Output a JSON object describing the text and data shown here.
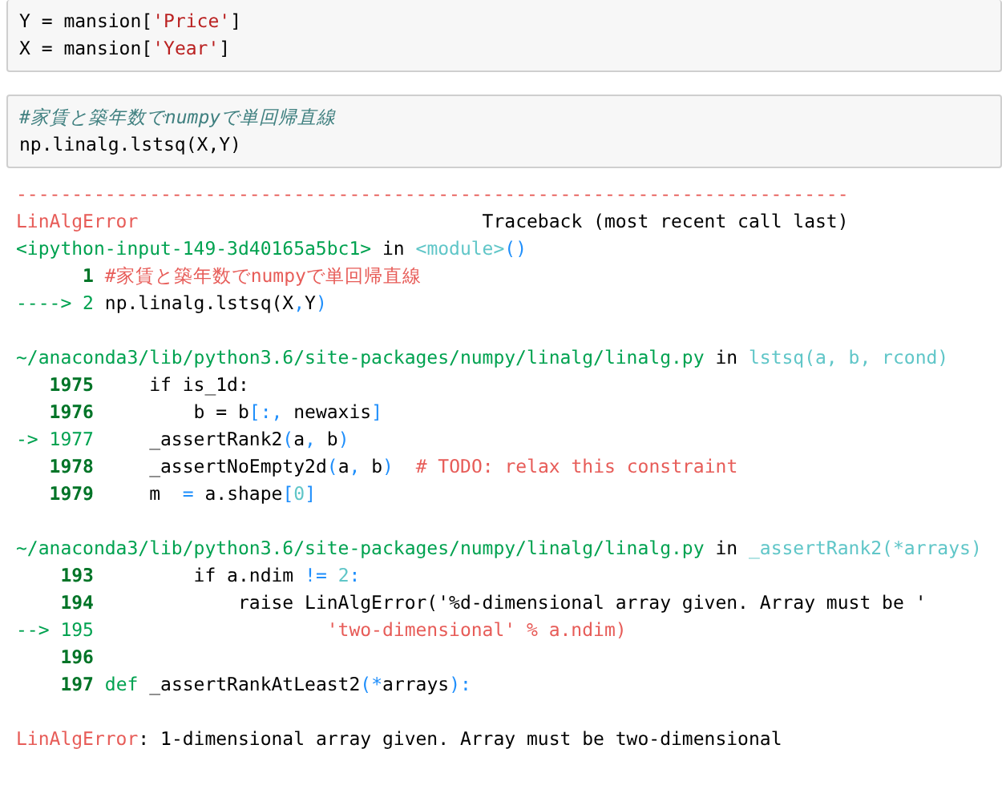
{
  "input_cells": [
    {
      "lines": [
        [
          {
            "kind": "text",
            "text": "Y = mansion["
          },
          {
            "kind": "str",
            "text": "'Price'"
          },
          {
            "kind": "text",
            "text": "]"
          }
        ],
        [
          {
            "kind": "text",
            "text": "X = mansion["
          },
          {
            "kind": "str",
            "text": "'Year'"
          },
          {
            "kind": "text",
            "text": "]"
          }
        ]
      ]
    },
    {
      "lines": [
        [
          {
            "kind": "comment",
            "text": "#家賃と築年数でnumpyで単回帰直線"
          }
        ],
        [
          {
            "kind": "text",
            "text": "np.linalg.lstsq(X,Y)"
          }
        ]
      ]
    }
  ],
  "traceback": {
    "blocks": [
      [
        [
          {
            "kind": "red",
            "text": "---------------------------------------------------------------------------"
          }
        ],
        [
          {
            "kind": "red",
            "text": "LinAlgError"
          },
          {
            "kind": "text",
            "text": "                               Traceback (most recent call last)"
          }
        ],
        [
          {
            "kind": "green",
            "text": "<ipython-input-149-3d40165a5bc1>"
          },
          {
            "kind": "text",
            "text": " in "
          },
          {
            "kind": "cyan",
            "text": "<module>"
          },
          {
            "kind": "blue",
            "text": "()"
          }
        ],
        [
          {
            "kind": "lineno",
            "text": "      1"
          },
          {
            "kind": "red",
            "text": " #家賃と築年数でnumpyで単回帰直線"
          }
        ],
        [
          {
            "kind": "green",
            "text": "----> 2"
          },
          {
            "kind": "text",
            "text": " np.linalg.lstsq(X"
          },
          {
            "kind": "blue",
            "text": ","
          },
          {
            "kind": "text",
            "text": "Y"
          },
          {
            "kind": "blue",
            "text": ")"
          }
        ]
      ],
      [
        [
          {
            "kind": "green",
            "text": "~/anaconda3/lib/python3.6/site-packages/numpy/linalg/linalg.py"
          },
          {
            "kind": "text",
            "text": " in "
          },
          {
            "kind": "cyan",
            "text": "lstsq(a, b, rcond)"
          }
        ],
        [
          {
            "kind": "lineno",
            "text": "   1975"
          },
          {
            "kind": "text",
            "text": "     if is_1d:"
          }
        ],
        [
          {
            "kind": "lineno",
            "text": "   1976"
          },
          {
            "kind": "text",
            "text": "         b = b"
          },
          {
            "kind": "blue",
            "text": "[:,"
          },
          {
            "kind": "text",
            "text": " newaxis"
          },
          {
            "kind": "blue",
            "text": "]"
          }
        ],
        [
          {
            "kind": "green",
            "text": "-> 1977"
          },
          {
            "kind": "text",
            "text": "     _assertRank2"
          },
          {
            "kind": "blue",
            "text": "("
          },
          {
            "kind": "text",
            "text": "a"
          },
          {
            "kind": "blue",
            "text": ","
          },
          {
            "kind": "text",
            "text": " b"
          },
          {
            "kind": "blue",
            "text": ")"
          }
        ],
        [
          {
            "kind": "lineno",
            "text": "   1978"
          },
          {
            "kind": "text",
            "text": "     _assertNoEmpty2d"
          },
          {
            "kind": "blue",
            "text": "("
          },
          {
            "kind": "text",
            "text": "a"
          },
          {
            "kind": "blue",
            "text": ","
          },
          {
            "kind": "text",
            "text": " b"
          },
          {
            "kind": "blue",
            "text": ")"
          },
          {
            "kind": "red",
            "text": "  # TODO: relax this constraint"
          }
        ],
        [
          {
            "kind": "lineno",
            "text": "   1979"
          },
          {
            "kind": "text",
            "text": "     m  "
          },
          {
            "kind": "blue",
            "text": "="
          },
          {
            "kind": "text",
            "text": " a.shape"
          },
          {
            "kind": "blue",
            "text": "["
          },
          {
            "kind": "cyan",
            "text": "0"
          },
          {
            "kind": "blue",
            "text": "]"
          }
        ]
      ],
      [
        [
          {
            "kind": "green",
            "text": "~/anaconda3/lib/python3.6/site-packages/numpy/linalg/linalg.py"
          },
          {
            "kind": "text",
            "text": " in "
          },
          {
            "kind": "cyan",
            "text": "_assertRank2(*arrays)"
          }
        ],
        [
          {
            "kind": "lineno",
            "text": "    193"
          },
          {
            "kind": "text",
            "text": "         if a.ndim "
          },
          {
            "kind": "blue",
            "text": "!="
          },
          {
            "kind": "cyan",
            "text": " 2"
          },
          {
            "kind": "blue",
            "text": ":"
          }
        ],
        [
          {
            "kind": "lineno",
            "text": "    194"
          },
          {
            "kind": "text",
            "text": "             raise LinAlgError('%d-dimensional array given. Array must be '"
          }
        ],
        [
          {
            "kind": "green",
            "text": "--> 195"
          },
          {
            "kind": "red",
            "text": "                     'two-dimensional' % a.ndim)"
          }
        ],
        [
          {
            "kind": "lineno",
            "text": "    196"
          }
        ],
        [
          {
            "kind": "lineno",
            "text": "    197"
          },
          {
            "kind": "green",
            "text": " def"
          },
          {
            "kind": "text",
            "text": " _assertRankAtLeast2"
          },
          {
            "kind": "blue",
            "text": "(*"
          },
          {
            "kind": "text",
            "text": "arrays"
          },
          {
            "kind": "blue",
            "text": "):"
          }
        ]
      ],
      [
        [
          {
            "kind": "red",
            "text": "LinAlgError"
          },
          {
            "kind": "text",
            "text": ": 1-dimensional array given. Array must be two-dimensional"
          }
        ]
      ]
    ]
  }
}
